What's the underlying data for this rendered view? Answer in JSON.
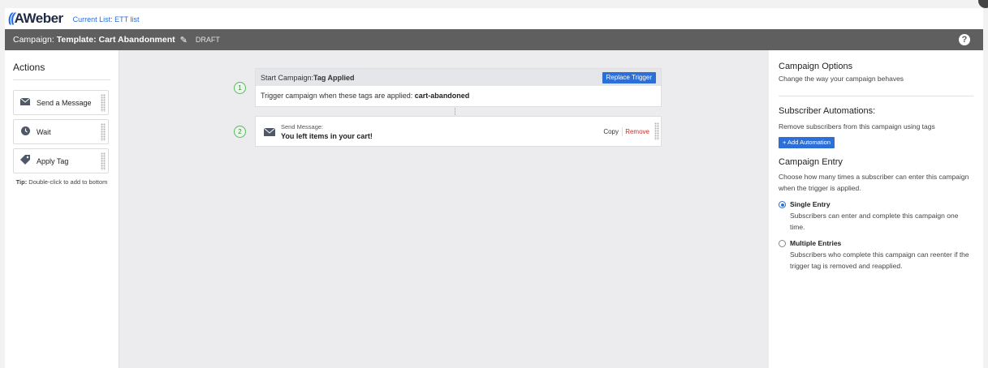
{
  "app": {
    "logo_mark": "((",
    "logo_text": "AWeber",
    "current_list": "Current List: ETT list"
  },
  "campaign": {
    "label": "Campaign:",
    "name": "Template: Cart Abandonment",
    "status": "DRAFT",
    "help": "?"
  },
  "actions": {
    "title": "Actions",
    "items": [
      {
        "label": "Send a Message",
        "icon": "envelope-icon"
      },
      {
        "label": "Wait",
        "icon": "clock-icon"
      },
      {
        "label": "Apply Tag",
        "icon": "tag-icon"
      }
    ],
    "tip_label": "Tip:",
    "tip_text": "Double-click to add to bottom"
  },
  "workflow": {
    "step1_number": "1",
    "trigger_prefix": "Start Campaign:",
    "trigger_type": "Tag Applied",
    "replace_button": "Replace Trigger",
    "trigger_desc": "Trigger campaign when these tags are applied:",
    "trigger_tag": "cart-abandoned",
    "step2_number": "2",
    "message_label": "Send Message:",
    "message_subject": "You left items in your cart!",
    "copy": "Copy",
    "remove": "Remove"
  },
  "options": {
    "title": "Campaign Options",
    "subtitle": "Change the way your campaign behaves",
    "automations_title": "Subscriber Automations:",
    "automations_desc": "Remove subscribers from this campaign using tags",
    "add_automation": "+ Add Automation",
    "entry_title": "Campaign Entry",
    "entry_desc": "Choose how many times a subscriber can enter this campaign when the trigger is applied.",
    "single_title": "Single Entry",
    "single_desc": "Subscribers can enter and complete this campaign one time.",
    "multiple_title": "Multiple Entries",
    "multiple_desc": "Subscribers who complete this campaign can reenter if the trigger tag is removed and reapplied.",
    "selected": "Single Entry"
  },
  "colors": {
    "accent": "#2d6fd8",
    "header_bg": "#5f5f5f",
    "remove": "#c9302c",
    "step_green": "#5cb85c"
  }
}
